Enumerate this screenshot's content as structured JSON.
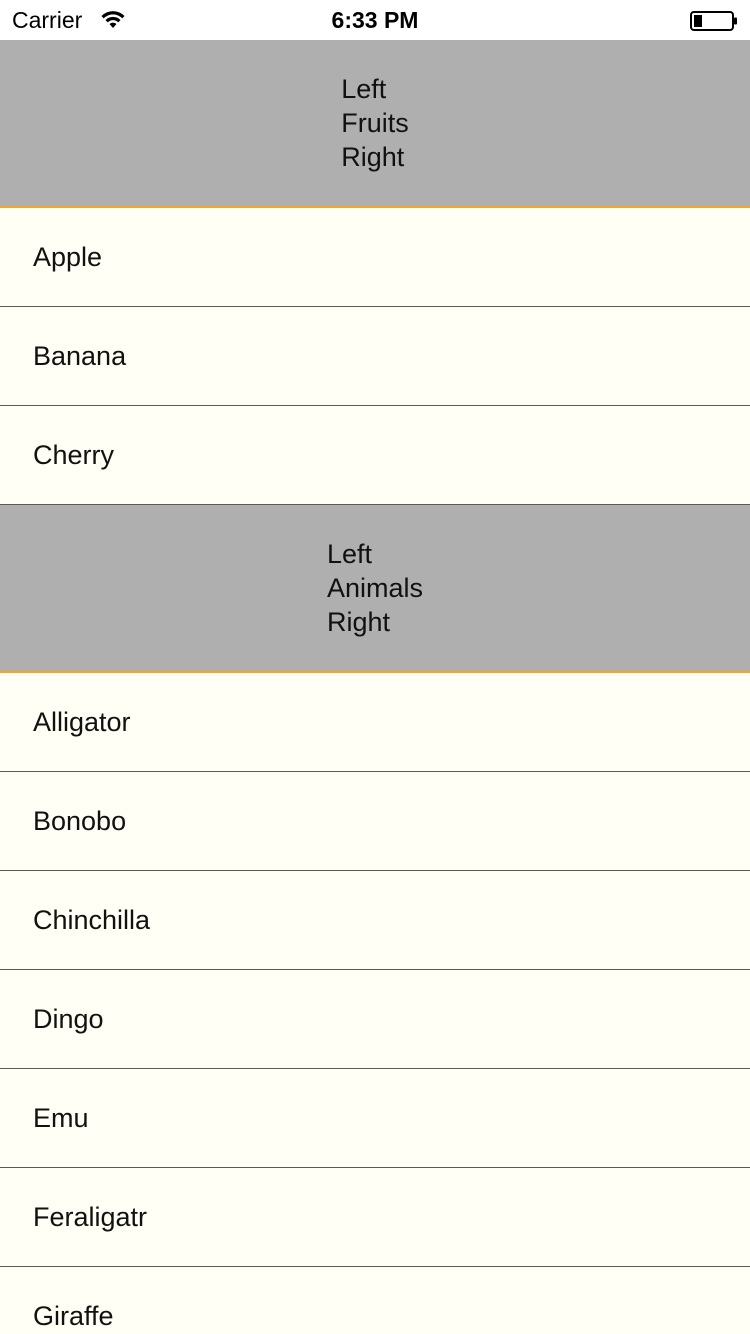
{
  "status_bar": {
    "carrier": "Carrier",
    "time": "6:33 PM",
    "wifi_icon": "wifi-icon",
    "battery_icon": "battery-icon"
  },
  "colors": {
    "header_bg": "#afafaf",
    "header_divider": "#f5a623",
    "row_bg": "#fffff5",
    "separator": "#5a5a5a"
  },
  "sections": [
    {
      "header": {
        "left": "Left",
        "title": "Fruits",
        "right": "Right"
      },
      "rows": [
        "Apple",
        "Banana",
        "Cherry"
      ]
    },
    {
      "header": {
        "left": "Left",
        "title": "Animals",
        "right": "Right"
      },
      "rows": [
        "Alligator",
        "Bonobo",
        "Chinchilla",
        "Dingo",
        "Emu",
        "Feraligatr",
        "Giraffe"
      ]
    }
  ]
}
